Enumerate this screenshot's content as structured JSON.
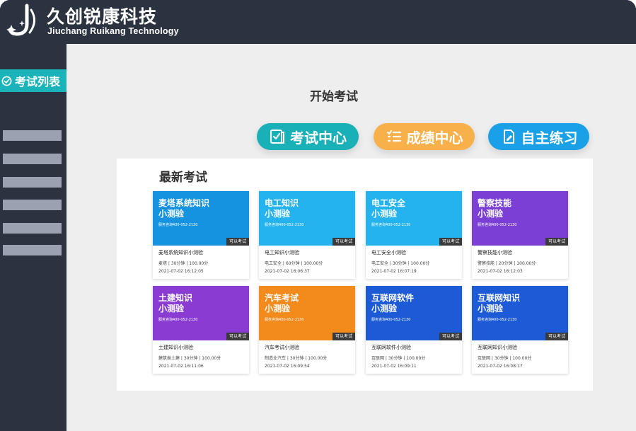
{
  "brand": {
    "name_cn": "久创锐康科技",
    "name_en": "Jiuchang Ruikang Technology"
  },
  "sidebar": {
    "active_label": "考试列表",
    "placeholder_items": 6
  },
  "page": {
    "title": "开始考试"
  },
  "actions": [
    {
      "label": "考试中心",
      "icon": "checklist-icon",
      "color": "#1ab0b8"
    },
    {
      "label": "成绩中心",
      "icon": "list-icon",
      "color": "#f7b04a"
    },
    {
      "label": "自主练习",
      "icon": "document-edit-icon",
      "color": "#1aa0e6"
    }
  ],
  "panel": {
    "title": "最新考试"
  },
  "exams": [
    {
      "cover_text": "麦塔系统知识\n小测验",
      "cover_sub": "服务咨询400-052-2130",
      "cover_bg": "#1693e0",
      "tag": "可以考试",
      "name": "麦塔系统知识小测验",
      "meta": "麦塔 | 30分钟 | 100.00分",
      "time": "2021-07-02 16:12:05"
    },
    {
      "cover_text": "电工知识\n小测验",
      "cover_sub": "服务咨询400-052-2130",
      "cover_bg": "#24b3ee",
      "tag": "可以考试",
      "name": "电工知识小测验",
      "meta": "电工安全 | 60分钟 | 100.00分",
      "time": "2021-07-02 16:06:37"
    },
    {
      "cover_text": "电工安全\n小测验",
      "cover_sub": "服务咨询400-052-2130",
      "cover_bg": "#24b3ee",
      "tag": "可以考试",
      "name": "电工安全小测验",
      "meta": "电工安全 | 30分钟 | 100.00分",
      "time": "2021-07-02 16:07:19"
    },
    {
      "cover_text": "警察技能\n小测验",
      "cover_sub": "服务咨询400-052-2130",
      "cover_bg": "#7b3fd6",
      "tag": "可以考试",
      "name": "警察技能小测验",
      "meta": "警察技能 | 20分钟 | 100.00分",
      "time": "2021-07-02 16:12:03"
    },
    {
      "cover_text": "土建知识\n小测验",
      "cover_sub": "服务咨询400-052-2130",
      "cover_bg": "#8a3bd2",
      "tag": "可以考试",
      "name": "土建知识小测验",
      "meta": "建筑类土建 | 30分钟 | 100.00分",
      "time": "2021-07-02 16:11:06"
    },
    {
      "cover_text": "汽车考试\n小测验",
      "cover_sub": "服务咨询400-052-2130",
      "cover_bg": "#f28a1c",
      "tag": "可以考试",
      "name": "汽车考试小测验",
      "meta": "制造业汽车 | 30分钟 | 100.00分",
      "time": "2021-07-02 16:09:54"
    },
    {
      "cover_text": "互联网软件\n小测验",
      "cover_sub": "服务咨询400-052-2130",
      "cover_bg": "#1d5bd6",
      "tag": "可以考试",
      "name": "互联网软件小测验",
      "meta": "互联网 | 30分钟 | 100.00分",
      "time": "2021-07-02 16:09:11"
    },
    {
      "cover_text": "互联网知识\n小测验",
      "cover_sub": "服务咨询400-052-2130",
      "cover_bg": "#1d5bd6",
      "tag": "可以考试",
      "name": "互联网知识小测验",
      "meta": "互联网 | 30分钟 | 100.00分",
      "time": "2021-07-02 16:08:17"
    }
  ]
}
